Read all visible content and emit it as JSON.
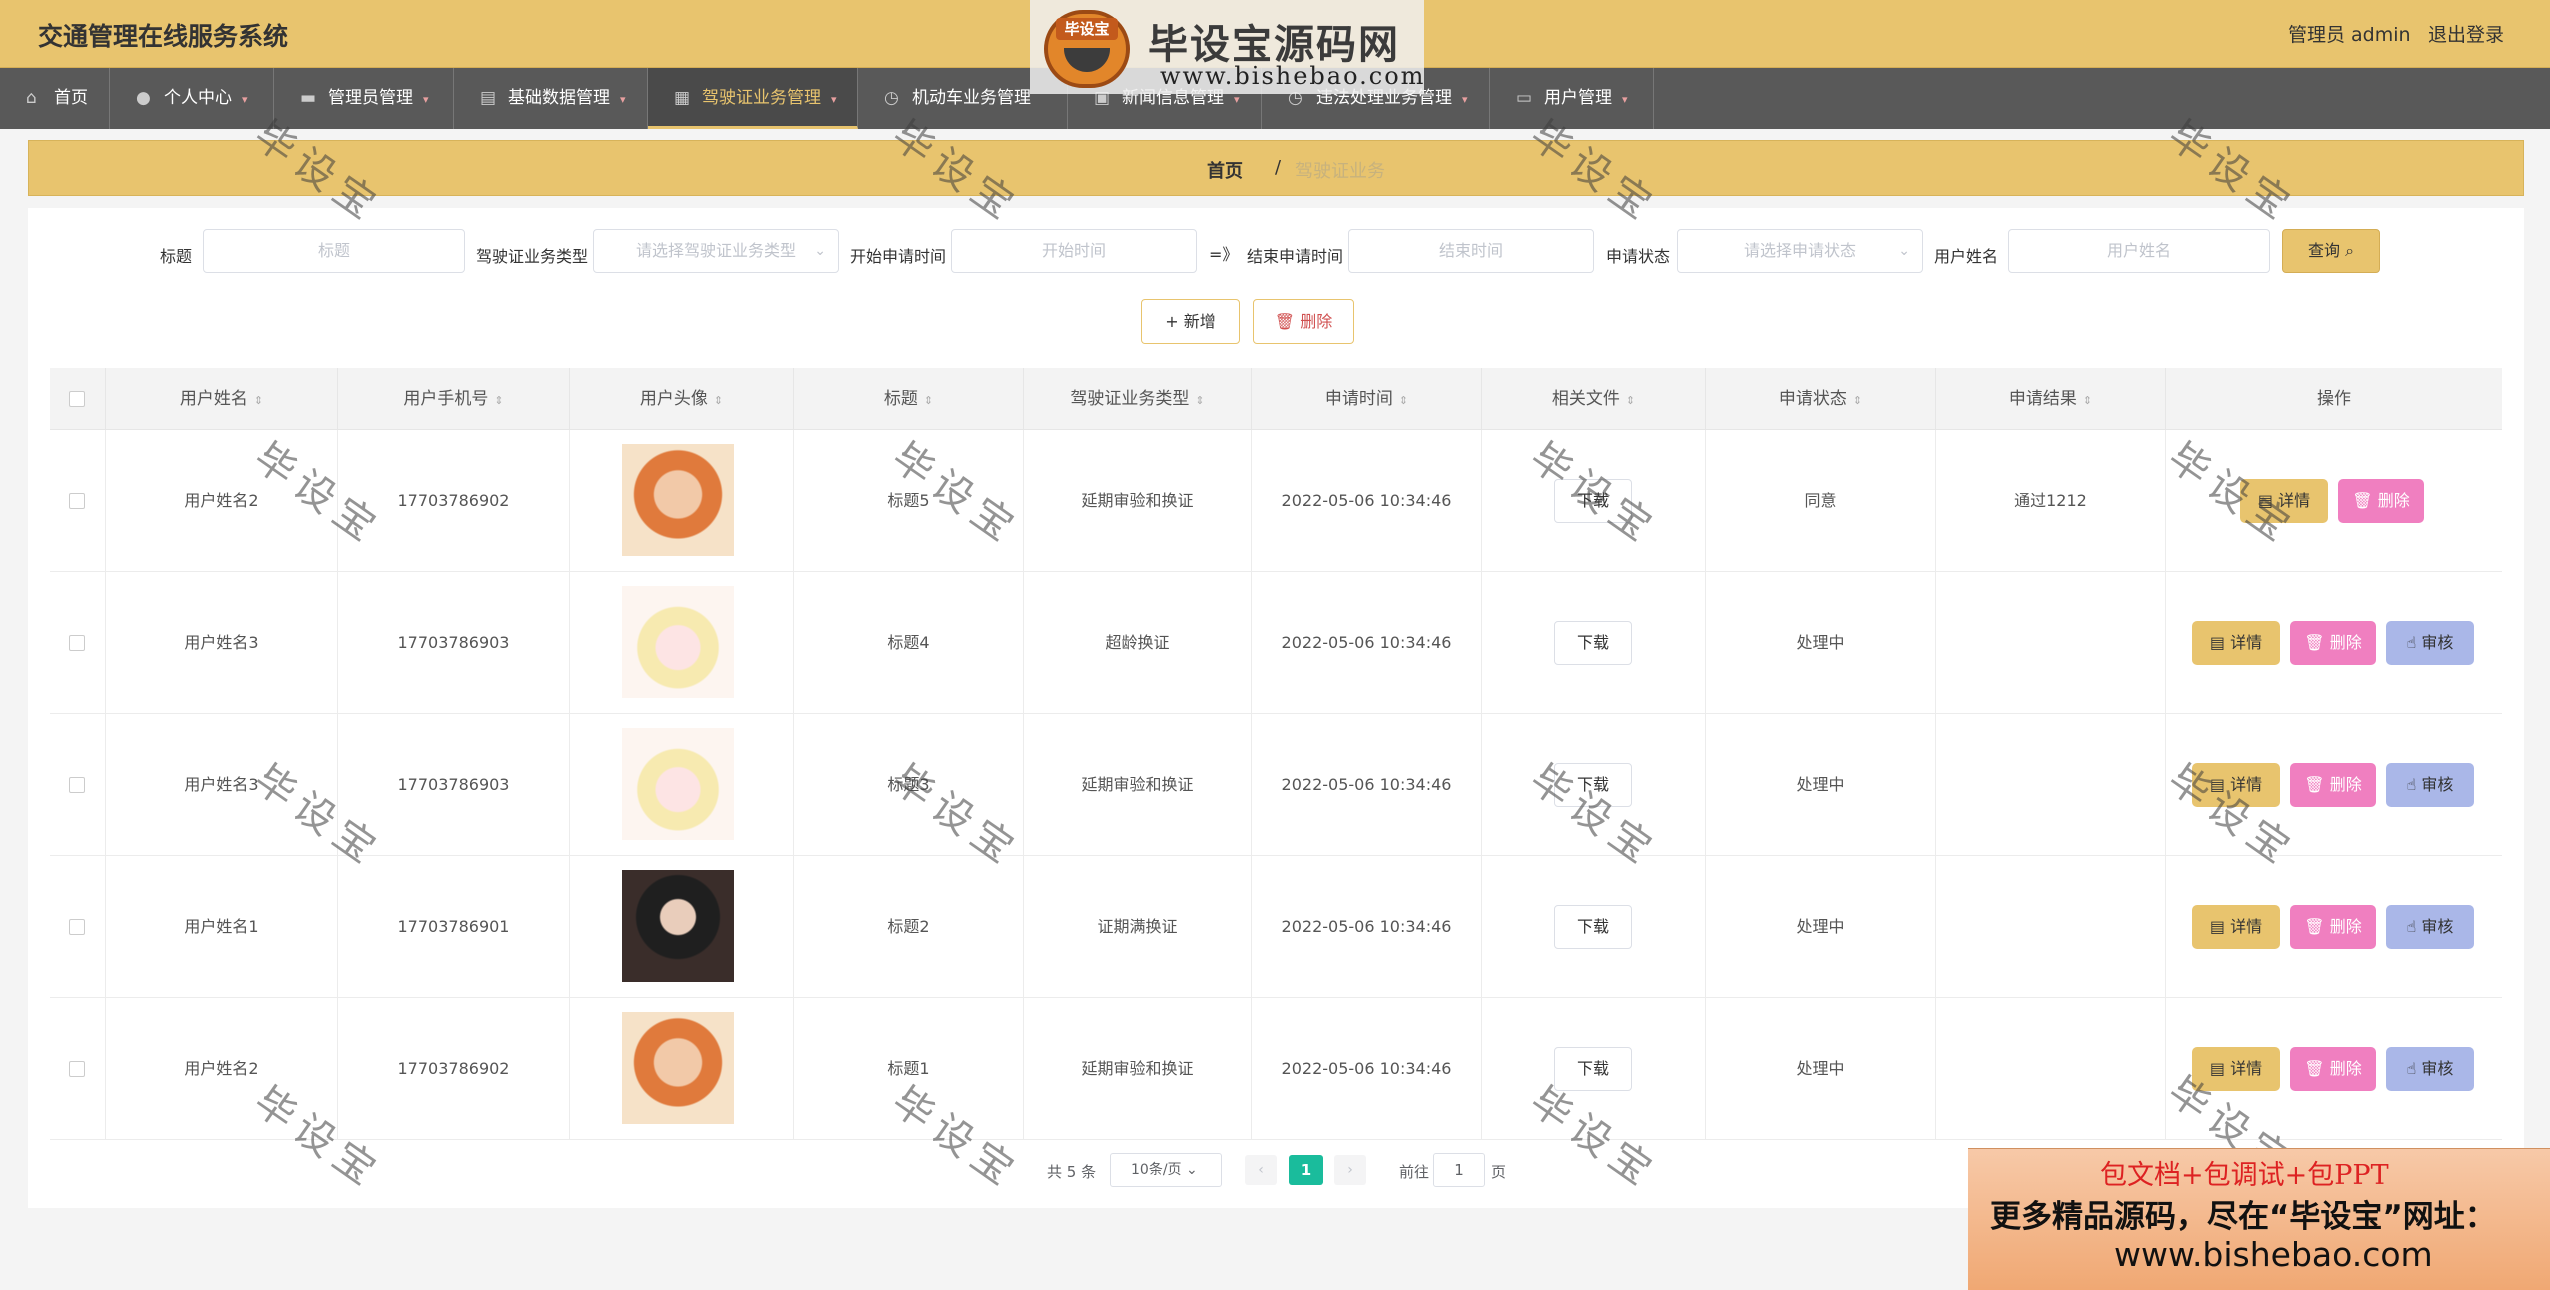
{
  "header": {
    "app_title": "交通管理在线服务系统",
    "admin_label": "管理员 admin",
    "logout_label": "退出登录"
  },
  "logo": {
    "badge": "毕设宝",
    "main_text": "毕设宝源码网",
    "url": "www.bishebao.com"
  },
  "nav": {
    "items": [
      {
        "label": "首页",
        "icon": "home-icon"
      },
      {
        "label": "个人中心",
        "icon": "user-icon"
      },
      {
        "label": "管理员管理",
        "icon": "admin-icon"
      },
      {
        "label": "基础数据管理",
        "icon": "clipboard-icon"
      },
      {
        "label": "驾驶证业务管理",
        "icon": "grid-icon"
      },
      {
        "label": "机动车业务管理",
        "icon": "clock-icon"
      },
      {
        "label": "新闻信息管理",
        "icon": "news-icon"
      },
      {
        "label": "违法处理业务管理",
        "icon": "clock-icon"
      },
      {
        "label": "用户管理",
        "icon": "card-icon"
      }
    ]
  },
  "breadcrumb": {
    "home": "首页",
    "separator": "/",
    "current": "驾驶证业务"
  },
  "filters": {
    "title_label": "标题",
    "title_placeholder": "标题",
    "type_label": "驾驶证业务类型",
    "type_placeholder": "请选择驾驶证业务类型",
    "start_label": "开始申请时间",
    "start_placeholder": "开始时间",
    "range_separator": "=》",
    "end_label": "结束申请时间",
    "end_placeholder": "结束时间",
    "status_label": "申请状态",
    "status_placeholder": "请选择申请状态",
    "username_label": "用户姓名",
    "username_placeholder": "用户姓名",
    "query_label": "查询"
  },
  "actions": {
    "add_label": "+ 新增",
    "delete_label": "删除"
  },
  "table": {
    "columns": [
      "用户姓名",
      "用户手机号",
      "用户头像",
      "标题",
      "驾驶证业务类型",
      "申请时间",
      "相关文件",
      "申请状态",
      "申请结果",
      "操作"
    ],
    "download_label": "下载",
    "detail_label": "详情",
    "delete_label": "删除",
    "audit_label": "审核",
    "rows": [
      {
        "name": "用户姓名2",
        "phone": "17703786902",
        "avatar": "orange-hair-photo",
        "title": "标题5",
        "type": "延期审验和换证",
        "time": "2022-05-06 10:34:46",
        "status": "同意",
        "result": "通过1212",
        "can_audit": false
      },
      {
        "name": "用户姓名3",
        "phone": "17703786903",
        "avatar": "anime-girl-photo",
        "title": "标题4",
        "type": "超龄换证",
        "time": "2022-05-06 10:34:46",
        "status": "处理中",
        "result": "",
        "can_audit": true
      },
      {
        "name": "用户姓名3",
        "phone": "17703786903",
        "avatar": "anime-girl-photo",
        "title": "标题3",
        "type": "延期审验和换证",
        "time": "2022-05-06 10:34:46",
        "status": "处理中",
        "result": "",
        "can_audit": true
      },
      {
        "name": "用户姓名1",
        "phone": "17703786901",
        "avatar": "dark-hair-photo",
        "title": "标题2",
        "type": "证期满换证",
        "time": "2022-05-06 10:34:46",
        "status": "处理中",
        "result": "",
        "can_audit": true
      },
      {
        "name": "用户姓名2",
        "phone": "17703786902",
        "avatar": "orange-hair-photo",
        "title": "标题1",
        "type": "延期审验和换证",
        "time": "2022-05-06 10:34:46",
        "status": "处理中",
        "result": "",
        "can_audit": true
      }
    ]
  },
  "pagination": {
    "total": "共 5 条",
    "page_size": "10条/页",
    "current_page": "1",
    "goto_label": "前往",
    "goto_value": "1",
    "page_suffix": "页"
  },
  "promo": {
    "line1": "包文档+包调试+包PPT",
    "line2": "更多精品源码，尽在“毕设宝”网址：",
    "line3": "www.bishebao.com"
  },
  "watermark": "毕设宝",
  "colors": {
    "accent": "#e8c46e",
    "nav_bg": "#595959",
    "delete_pink": "#f07fc0",
    "audit_blue": "#aab7e8",
    "page_active": "#1abc9c"
  }
}
